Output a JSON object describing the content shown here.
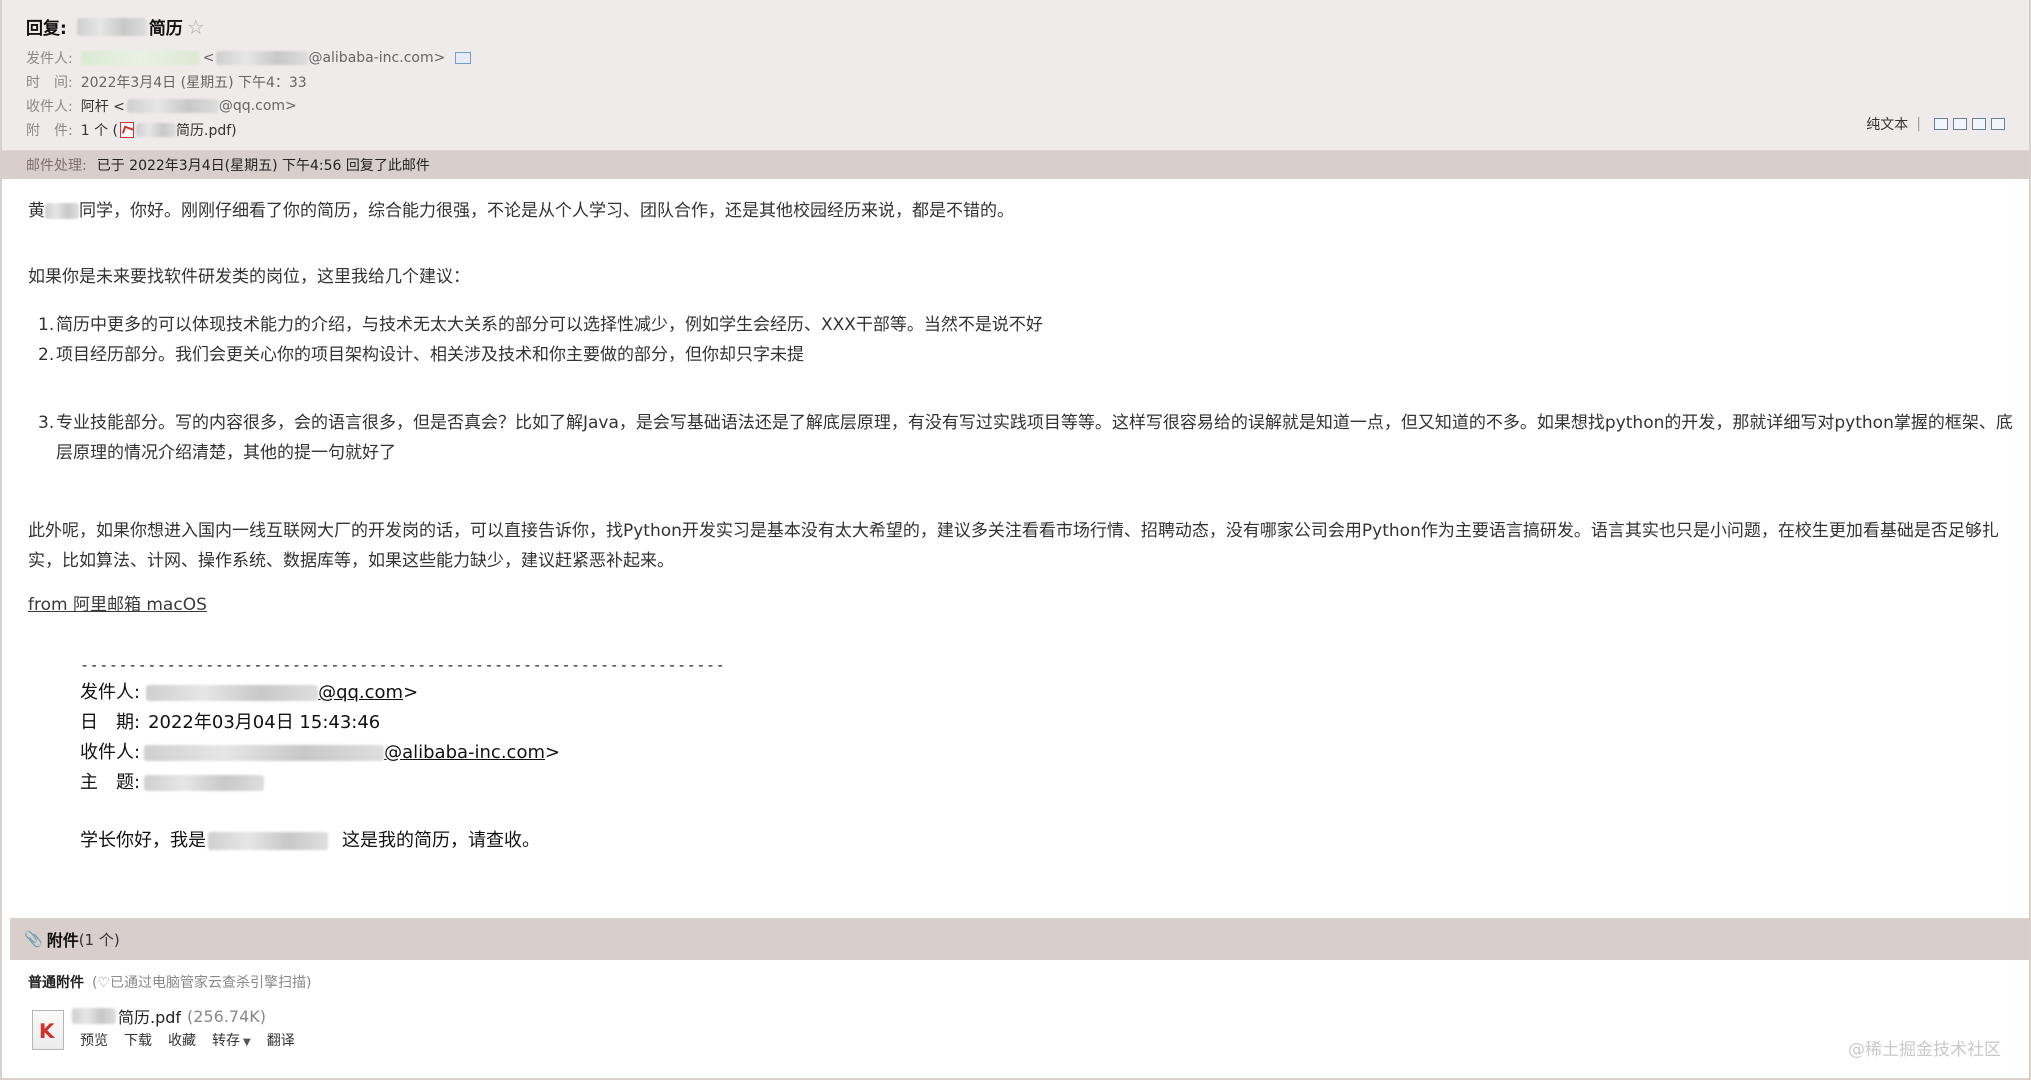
{
  "header": {
    "subject_prefix": "回复:",
    "subject_suffix": "简历",
    "from_label": "发件人:",
    "from_domain": "@alibaba-inc.com>",
    "from_bracket_open": "<",
    "time_label": "时　间:",
    "time_value": "2022年3月4日 (星期五) 下午4：33",
    "to_label": "收件人:",
    "to_name": "阿杆 <",
    "to_domain": "@qq.com>",
    "attach_label": "附　件:",
    "attach_count": "1 个 (",
    "attach_file": "简历.pdf)",
    "star_icon": "☆"
  },
  "toolbar": {
    "plain_text": "纯文本",
    "separator": "|"
  },
  "process": {
    "label": "邮件处理:",
    "value": "已于 2022年3月4日(星期五) 下午4:56 回复了此邮件"
  },
  "body": {
    "greeting_name": "黄",
    "greeting_rest": "同学，你好。刚刚仔细看了你的简历，综合能力很强，不论是从个人学习、团队合作，还是其他校园经历来说，都是不错的。",
    "intro": "如果你是未来要找软件研发类的岗位，这里我给几个建议：",
    "advice": [
      {
        "num": "1.",
        "text": "简历中更多的可以体现技术能力的介绍，与技术无太大关系的部分可以选择性减少，例如学生会经历、XXX干部等。当然不是说不好"
      },
      {
        "num": "2.",
        "text": "项目经历部分。我们会更关心你的项目架构设计、相关涉及技术和你主要做的部分，但你却只字未提"
      },
      {
        "num": "3.",
        "text": "专业技能部分。写的内容很多，会的语言很多，但是否真会？比如了解Java，是会写基础语法还是了解底层原理，有没有写过实践项目等等。这样写很容易给的误解就是知道一点，但又知道的不多。如果想找python的开发，那就详细写对python掌握的框架、底层原理的情况介绍清楚，其他的提一句就好了"
      }
    ],
    "closing": "此外呢，如果你想进入国内一线互联网大厂的开发岗的话，可以直接告诉你，找Python开发实习是基本没有太大希望的，建议多关注看看市场行情、招聘动态，没有哪家公司会用Python作为主要语言搞研发。语言其实也只是小问题，在校生更加看基础是否足够扎实，比如算法、计网、操作系统、数据库等，如果这些能力缺少，建议赶紧恶补起来。",
    "signature": "from 阿里邮箱 macOS"
  },
  "quote": {
    "divider": "-------------------------------------------------------------------",
    "from_label": "发件人:",
    "from_link": "@qq.com",
    "from_close": ">",
    "date_label": "日　期:",
    "date_value": "2022年03月04日 15:43:46",
    "to_label": "收件人:",
    "to_link": "@alibaba-inc.com",
    "to_close": ">",
    "subject_label": "主　题:",
    "message_start": "学长你好，我是",
    "message_end": "这是我的简历，请查收。"
  },
  "attachments": {
    "title": "附件",
    "count": "(1 个)",
    "section_label": "普通附件",
    "scan_note": "(♡已通过电脑管家云查杀引擎扫描)",
    "file_name": "简历.pdf",
    "file_size": "(256.74K)",
    "actions": [
      "预览",
      "下载",
      "收藏",
      "转存",
      "翻译"
    ]
  },
  "watermark": "@稀土掘金技术社区"
}
